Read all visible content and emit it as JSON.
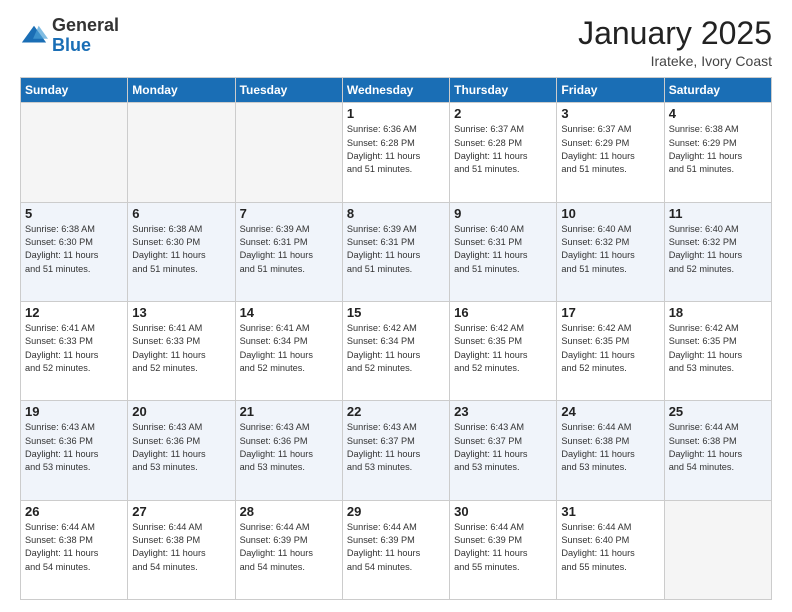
{
  "logo": {
    "general": "General",
    "blue": "Blue"
  },
  "header": {
    "month_title": "January 2025",
    "subtitle": "Irateke, Ivory Coast"
  },
  "days_of_week": [
    "Sunday",
    "Monday",
    "Tuesday",
    "Wednesday",
    "Thursday",
    "Friday",
    "Saturday"
  ],
  "weeks": [
    [
      {
        "day": "",
        "info": ""
      },
      {
        "day": "",
        "info": ""
      },
      {
        "day": "",
        "info": ""
      },
      {
        "day": "1",
        "info": "Sunrise: 6:36 AM\nSunset: 6:28 PM\nDaylight: 11 hours\nand 51 minutes."
      },
      {
        "day": "2",
        "info": "Sunrise: 6:37 AM\nSunset: 6:28 PM\nDaylight: 11 hours\nand 51 minutes."
      },
      {
        "day": "3",
        "info": "Sunrise: 6:37 AM\nSunset: 6:29 PM\nDaylight: 11 hours\nand 51 minutes."
      },
      {
        "day": "4",
        "info": "Sunrise: 6:38 AM\nSunset: 6:29 PM\nDaylight: 11 hours\nand 51 minutes."
      }
    ],
    [
      {
        "day": "5",
        "info": "Sunrise: 6:38 AM\nSunset: 6:30 PM\nDaylight: 11 hours\nand 51 minutes."
      },
      {
        "day": "6",
        "info": "Sunrise: 6:38 AM\nSunset: 6:30 PM\nDaylight: 11 hours\nand 51 minutes."
      },
      {
        "day": "7",
        "info": "Sunrise: 6:39 AM\nSunset: 6:31 PM\nDaylight: 11 hours\nand 51 minutes."
      },
      {
        "day": "8",
        "info": "Sunrise: 6:39 AM\nSunset: 6:31 PM\nDaylight: 11 hours\nand 51 minutes."
      },
      {
        "day": "9",
        "info": "Sunrise: 6:40 AM\nSunset: 6:31 PM\nDaylight: 11 hours\nand 51 minutes."
      },
      {
        "day": "10",
        "info": "Sunrise: 6:40 AM\nSunset: 6:32 PM\nDaylight: 11 hours\nand 51 minutes."
      },
      {
        "day": "11",
        "info": "Sunrise: 6:40 AM\nSunset: 6:32 PM\nDaylight: 11 hours\nand 52 minutes."
      }
    ],
    [
      {
        "day": "12",
        "info": "Sunrise: 6:41 AM\nSunset: 6:33 PM\nDaylight: 11 hours\nand 52 minutes."
      },
      {
        "day": "13",
        "info": "Sunrise: 6:41 AM\nSunset: 6:33 PM\nDaylight: 11 hours\nand 52 minutes."
      },
      {
        "day": "14",
        "info": "Sunrise: 6:41 AM\nSunset: 6:34 PM\nDaylight: 11 hours\nand 52 minutes."
      },
      {
        "day": "15",
        "info": "Sunrise: 6:42 AM\nSunset: 6:34 PM\nDaylight: 11 hours\nand 52 minutes."
      },
      {
        "day": "16",
        "info": "Sunrise: 6:42 AM\nSunset: 6:35 PM\nDaylight: 11 hours\nand 52 minutes."
      },
      {
        "day": "17",
        "info": "Sunrise: 6:42 AM\nSunset: 6:35 PM\nDaylight: 11 hours\nand 52 minutes."
      },
      {
        "day": "18",
        "info": "Sunrise: 6:42 AM\nSunset: 6:35 PM\nDaylight: 11 hours\nand 53 minutes."
      }
    ],
    [
      {
        "day": "19",
        "info": "Sunrise: 6:43 AM\nSunset: 6:36 PM\nDaylight: 11 hours\nand 53 minutes."
      },
      {
        "day": "20",
        "info": "Sunrise: 6:43 AM\nSunset: 6:36 PM\nDaylight: 11 hours\nand 53 minutes."
      },
      {
        "day": "21",
        "info": "Sunrise: 6:43 AM\nSunset: 6:36 PM\nDaylight: 11 hours\nand 53 minutes."
      },
      {
        "day": "22",
        "info": "Sunrise: 6:43 AM\nSunset: 6:37 PM\nDaylight: 11 hours\nand 53 minutes."
      },
      {
        "day": "23",
        "info": "Sunrise: 6:43 AM\nSunset: 6:37 PM\nDaylight: 11 hours\nand 53 minutes."
      },
      {
        "day": "24",
        "info": "Sunrise: 6:44 AM\nSunset: 6:38 PM\nDaylight: 11 hours\nand 53 minutes."
      },
      {
        "day": "25",
        "info": "Sunrise: 6:44 AM\nSunset: 6:38 PM\nDaylight: 11 hours\nand 54 minutes."
      }
    ],
    [
      {
        "day": "26",
        "info": "Sunrise: 6:44 AM\nSunset: 6:38 PM\nDaylight: 11 hours\nand 54 minutes."
      },
      {
        "day": "27",
        "info": "Sunrise: 6:44 AM\nSunset: 6:38 PM\nDaylight: 11 hours\nand 54 minutes."
      },
      {
        "day": "28",
        "info": "Sunrise: 6:44 AM\nSunset: 6:39 PM\nDaylight: 11 hours\nand 54 minutes."
      },
      {
        "day": "29",
        "info": "Sunrise: 6:44 AM\nSunset: 6:39 PM\nDaylight: 11 hours\nand 54 minutes."
      },
      {
        "day": "30",
        "info": "Sunrise: 6:44 AM\nSunset: 6:39 PM\nDaylight: 11 hours\nand 55 minutes."
      },
      {
        "day": "31",
        "info": "Sunrise: 6:44 AM\nSunset: 6:40 PM\nDaylight: 11 hours\nand 55 minutes."
      },
      {
        "day": "",
        "info": ""
      }
    ]
  ]
}
